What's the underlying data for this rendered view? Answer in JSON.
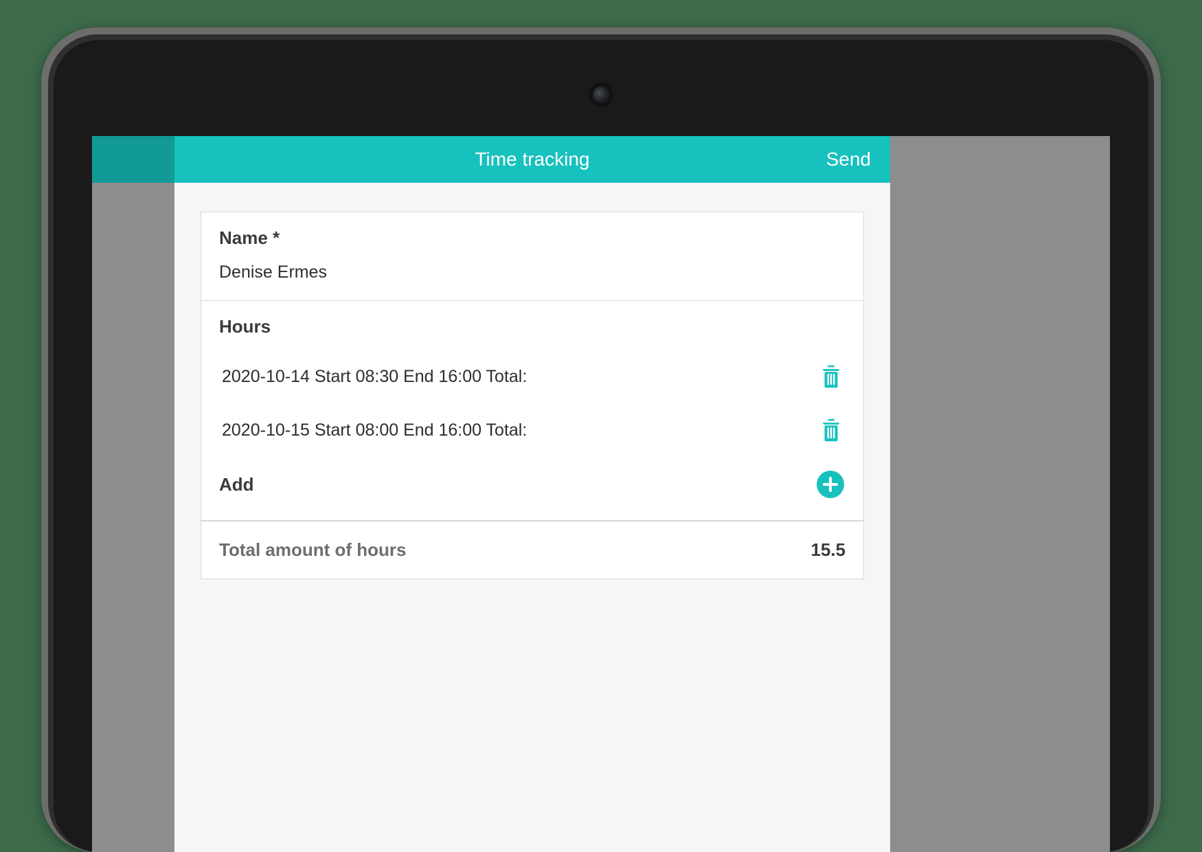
{
  "header": {
    "title": "Time tracking",
    "send_label": "Send"
  },
  "form": {
    "name_label": "Name *",
    "name_value": "Denise Ermes",
    "hours_label": "Hours",
    "entries": [
      {
        "text": "2020-10-14 Start 08:30 End 16:00 Total:"
      },
      {
        "text": "2020-10-15 Start 08:00 End 16:00 Total:"
      }
    ],
    "add_label": "Add",
    "total_label": "Total amount of hours",
    "total_value": "15.5"
  },
  "colors": {
    "accent": "#17c1bd"
  }
}
